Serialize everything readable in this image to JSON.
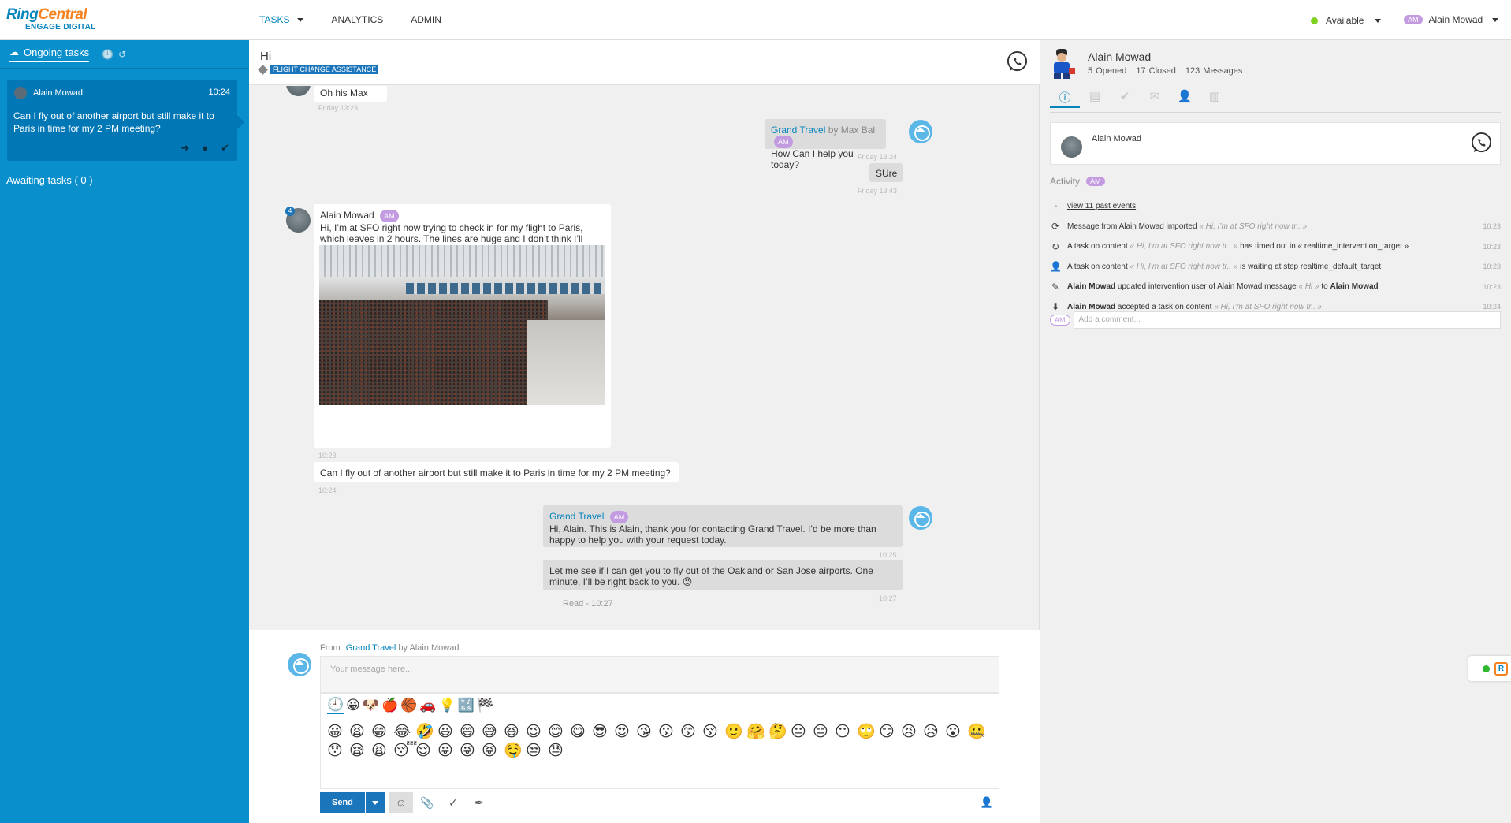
{
  "brand": {
    "name_part1": "Ring",
    "name_part2": "Central",
    "sub": "ENGAGE DIGITAL"
  },
  "nav": {
    "tasks": "TASKS",
    "analytics": "ANALYTICS",
    "admin": "ADMIN"
  },
  "status": {
    "label": "Available",
    "color": "#7ed321"
  },
  "user": {
    "initials": "AM",
    "name": "Alain Mowad"
  },
  "sidebar": {
    "tab_ongoing": "Ongoing tasks",
    "task": {
      "name": "Alain Mowad",
      "time": "10:24",
      "text": "Can I fly out of another airport but still make it to Paris in time for my 2 PM meeting?"
    },
    "awaiting": "Awaiting tasks ( 0 )"
  },
  "header": {
    "title": "Hi",
    "tag": "FLIGHT CHANGE ASSISTANCE"
  },
  "messages": {
    "m1_text": "Oh his Max",
    "m1_ts": "Friday 13:23",
    "m2_sender": "Grand Travel",
    "m2_by": "by Max Ball",
    "m2_badge": "AM",
    "m2_text": "How Can I help you today?",
    "m2_ts": "Friday 13:24",
    "m3_text": "SUre",
    "m3_ts": "Friday 13:43",
    "m4_sender": "Alain Mowad",
    "m4_badge": "AM",
    "m4_count": "4",
    "m4_text": "Hi, I’m at SFO right now trying to check in for my flight to Paris, which leaves in 2 hours. The lines are huge and I don’t think I’ll make this flight!",
    "m4_ts": "10:23",
    "m5_text": "Can I fly out of another airport but still make it to Paris in time for my 2 PM meeting?",
    "m5_ts": "10:24",
    "m6_sender": "Grand Travel",
    "m6_badge": "AM",
    "m6_text": "Hi, Alain. This is Alain, thank you for contacting Grand Travel. I’d be more than happy to help you with your request today.",
    "m6_ts": "10:25",
    "m7_text": "Let me see if I can get you to fly out of the Oakland or San Jose airports. One minute, I’ll be right back to you. 😉",
    "m7_ts": "10:27",
    "read_label": "Read - 10:27"
  },
  "composer": {
    "from_label": "From",
    "from_source": "Grand Travel",
    "from_by": "by Alain Mowad",
    "placeholder": "Your message here...",
    "send_label": "Send",
    "emoji_tabs": [
      "🕘",
      "😀",
      "🐶",
      "🍎",
      "🏀",
      "🚗",
      "💡",
      "🔣",
      "🏁"
    ],
    "emojis": [
      "😀",
      "😫",
      "😁",
      "😂",
      "🤣",
      "😃",
      "😄",
      "😅",
      "😆",
      "😉",
      "😊",
      "😋",
      "😎",
      "😍",
      "😘",
      "😗",
      "😙",
      "😚",
      "🙂",
      "🤗",
      "🤔",
      "😐",
      "😑",
      "😶",
      "🙄",
      "😏",
      "😣",
      "😥",
      "😮",
      "🤐",
      "😯",
      "😪",
      "😫",
      "😴",
      "😌",
      "😛",
      "😜",
      "😝",
      "🤤",
      "😒",
      "😓"
    ]
  },
  "profile": {
    "name": "Alain Mowad",
    "opened": "5 Opened",
    "closed": "17 Closed",
    "messages": "123 Messages",
    "contact_name": "Alain Mowad",
    "activity_label": "Activity",
    "activity_badge": "AM",
    "view_past": "view 11 past events",
    "comment_placeholder": "Add a comment...",
    "a1_text": "Message from Alain Mowad imported",
    "a1_q": "« Hi, I’m at SFO right now tr.. »",
    "a1_t": "10:23",
    "a2_text": "A task on content",
    "a2_q": "« Hi, I’m at SFO right now tr.. »",
    "a2_rest": "has timed out in « realtime_intervention_target »",
    "a2_t": "10:23",
    "a3_text": "A task on content",
    "a3_q": "« Hi, I’m at SFO right now tr.. »",
    "a3_rest": "is waiting at step realtime_default_target",
    "a3_t": "10:23",
    "a4_name": "Alain Mowad",
    "a4_text": "updated intervention user of Alain Mowad message",
    "a4_q": "« Hi »",
    "a4_to": "to",
    "a4_name2": "Alain Mowad",
    "a4_t": "10:23",
    "a5_name": "Alain Mowad",
    "a5_text": "accepted a task on content",
    "a5_q": "« Hi, I’m at SFO right now tr.. »",
    "a5_t": "10:24"
  },
  "colors": {
    "sidebar": "#0a8fcd",
    "accent": "#0684bc",
    "badge": "#c39be0"
  }
}
